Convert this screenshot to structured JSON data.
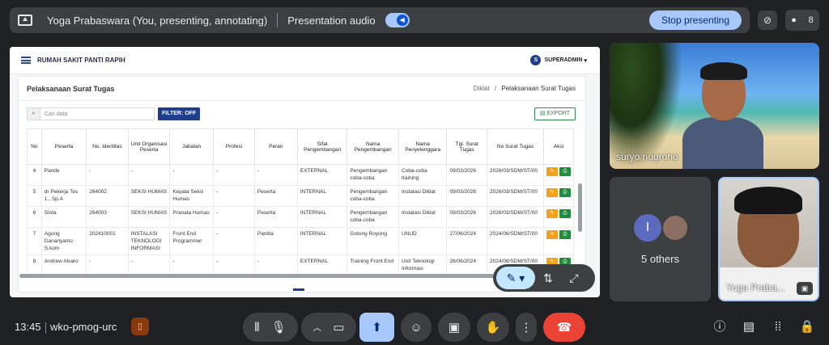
{
  "topbar": {
    "title": "Yoga Prabaswara (You, presenting, annotating)",
    "audio_label": "Presentation audio",
    "stop_label": "Stop presenting",
    "participant_count": "8"
  },
  "screen": {
    "app_title": "RUMAH SAKIT PANTI RAPIH",
    "user_initial": "S",
    "user_name": "SUPERADMIN",
    "page_title": "Pelaksanaan Surat Tugas",
    "breadcrumb_parent": "Diklat",
    "breadcrumb_sep": "/",
    "breadcrumb_current": "Pelaksanaan Surat Tugas",
    "search_placeholder": "Cari data",
    "filter_label": "FILTER: OFF",
    "export_label": "EXPORT",
    "columns": [
      "No",
      "Peserta",
      "No. Identitas",
      "Unit Organisasi Peserta",
      "Jabatan",
      "Profesi",
      "Peran",
      "Sifat Pengembangan",
      "Nama Pengembangan",
      "Nama Penyelenggara",
      "Tgl. Surat Tugas",
      "No Surat Tugas",
      "Aksi"
    ],
    "rows": [
      [
        "4",
        "Pande",
        "-",
        "-",
        "-",
        "-",
        "-",
        "EXTERNAL",
        "Pengembangan coba-coba",
        "Coba-coba training",
        "09/03/2026",
        "2026/03/SDM/ST/00"
      ],
      [
        "5",
        "dr Pekerja Tes 1., Sp.A",
        "264002",
        "SEKSI HUMAS",
        "Kepala Seksi Humas",
        "-",
        "Peserta",
        "INTERNAL",
        "Pengembangan coba-coba",
        "Instalasi Diklat",
        "09/03/2026",
        "2026/03/SDM/ST/00"
      ],
      [
        "6",
        "Sinta",
        "264003",
        "SEKSI HUMAS",
        "Pranata Humas",
        "-",
        "Peserta",
        "INTERNAL",
        "Pengembangan coba-coba",
        "Instalasi Diklat",
        "09/03/2026",
        "2026/03/SDM/ST/00"
      ],
      [
        "7",
        "Agung Danariyanto S.kom",
        "202410001",
        "INSTALASI TEKNOLOGI INFORMASI",
        "Front End Programmer",
        "-",
        "Panitia",
        "INTERNAL",
        "Gotong Royong",
        "UNUD",
        "27/06/2024",
        "2024/06/SDM/ST/00"
      ],
      [
        "8",
        "Andrew Alvaro",
        "-",
        "-",
        "-",
        "-",
        "-",
        "EXTERNAL",
        "Training Front End",
        "Unit Teknologi Informasi",
        "26/06/2024",
        "2024/06/SDM/ST/00"
      ]
    ]
  },
  "tiles": {
    "speaker_name": "suryo nugroho",
    "others_initial": "I",
    "others_label": "5 others",
    "self_name": "Yoga Praba..."
  },
  "bottombar": {
    "time": "13:45",
    "meeting_code": "wko-pmog-urc"
  },
  "colors": {
    "background": "#202124",
    "accent": "#a8c7fa",
    "end_call": "#ea4335",
    "brand_navy": "#1f3d8a",
    "edit_orange": "#f4a11a",
    "view_green": "#1e8e3e"
  },
  "icons": [
    "present-icon",
    "audio-icon",
    "camera-off-icon",
    "people-icon",
    "pen-icon",
    "swap-icon",
    "expand-icon",
    "mic-icon",
    "camera-icon",
    "present-now-icon",
    "emoji-icon",
    "captions-icon",
    "hand-icon",
    "more-icon",
    "end-call-icon",
    "info-icon",
    "chat-icon",
    "activities-icon",
    "lock-icon"
  ]
}
